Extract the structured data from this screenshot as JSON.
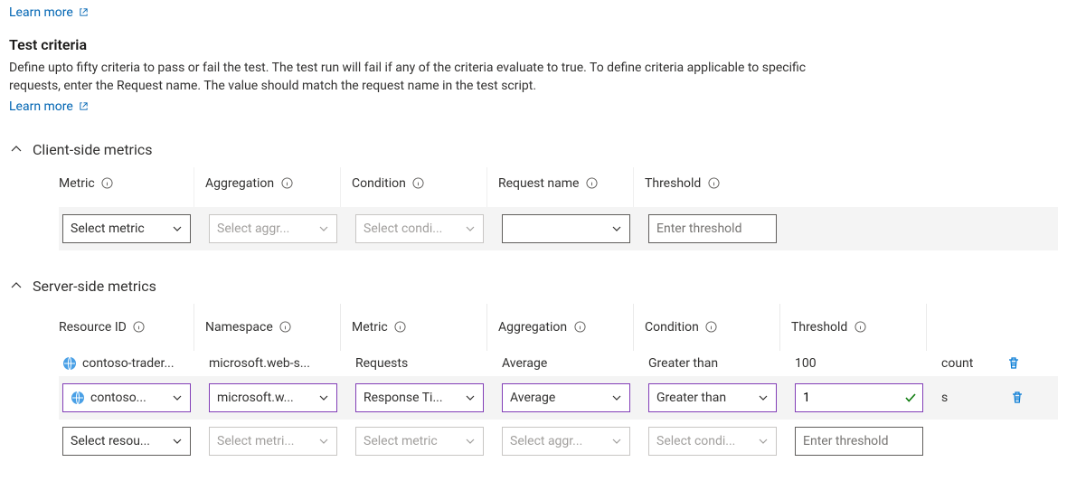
{
  "top_learn_more": "Learn more",
  "section": {
    "title": "Test criteria",
    "description": "Define upto fifty criteria to pass or fail the test. The test run will fail if any of the criteria evaluate to true. To define criteria applicable to specific requests, enter the Request name. The value should match the request name in the test script.",
    "learn_more": "Learn more"
  },
  "client": {
    "header": "Client-side metrics",
    "columns": {
      "metric": "Metric",
      "aggregation": "Aggregation",
      "condition": "Condition",
      "request_name": "Request name",
      "threshold": "Threshold"
    },
    "row": {
      "metric_placeholder": "Select metric",
      "aggregation_placeholder": "Select aggr...",
      "condition_placeholder": "Select condi...",
      "request_name_value": "",
      "threshold_placeholder": "Enter threshold"
    }
  },
  "server": {
    "header": "Server-side metrics",
    "columns": {
      "resource_id": "Resource ID",
      "namespace": "Namespace",
      "metric": "Metric",
      "aggregation": "Aggregation",
      "condition": "Condition",
      "threshold": "Threshold"
    },
    "rows": [
      {
        "resource": "contoso-trader...",
        "namespace": "microsoft.web-s...",
        "metric": "Requests",
        "aggregation": "Average",
        "condition": "Greater than",
        "threshold": "100",
        "unit": "count"
      },
      {
        "resource": "contoso...",
        "namespace": "microsoft.w...",
        "metric": "Response Ti...",
        "aggregation": "Average",
        "condition": "Greater than",
        "threshold": "1",
        "unit": "s"
      },
      {
        "resource_placeholder": "Select resou...",
        "namespace_placeholder": "Select metri...",
        "metric_placeholder": "Select metric",
        "aggregation_placeholder": "Select aggr...",
        "condition_placeholder": "Select condi...",
        "threshold_placeholder": "Enter threshold"
      }
    ]
  }
}
